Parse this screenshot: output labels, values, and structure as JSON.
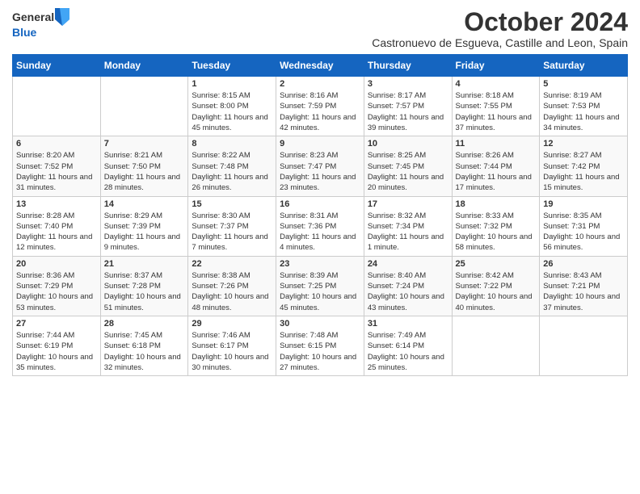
{
  "header": {
    "logo_general": "General",
    "logo_blue": "Blue",
    "main_title": "October 2024",
    "subtitle": "Castronuevo de Esgueva, Castille and Leon, Spain"
  },
  "days_of_week": [
    "Sunday",
    "Monday",
    "Tuesday",
    "Wednesday",
    "Thursday",
    "Friday",
    "Saturday"
  ],
  "weeks": [
    [
      {
        "day": "",
        "sunrise": "",
        "sunset": "",
        "daylight": ""
      },
      {
        "day": "",
        "sunrise": "",
        "sunset": "",
        "daylight": ""
      },
      {
        "day": "1",
        "sunrise": "Sunrise: 8:15 AM",
        "sunset": "Sunset: 8:00 PM",
        "daylight": "Daylight: 11 hours and 45 minutes."
      },
      {
        "day": "2",
        "sunrise": "Sunrise: 8:16 AM",
        "sunset": "Sunset: 7:59 PM",
        "daylight": "Daylight: 11 hours and 42 minutes."
      },
      {
        "day": "3",
        "sunrise": "Sunrise: 8:17 AM",
        "sunset": "Sunset: 7:57 PM",
        "daylight": "Daylight: 11 hours and 39 minutes."
      },
      {
        "day": "4",
        "sunrise": "Sunrise: 8:18 AM",
        "sunset": "Sunset: 7:55 PM",
        "daylight": "Daylight: 11 hours and 37 minutes."
      },
      {
        "day": "5",
        "sunrise": "Sunrise: 8:19 AM",
        "sunset": "Sunset: 7:53 PM",
        "daylight": "Daylight: 11 hours and 34 minutes."
      }
    ],
    [
      {
        "day": "6",
        "sunrise": "Sunrise: 8:20 AM",
        "sunset": "Sunset: 7:52 PM",
        "daylight": "Daylight: 11 hours and 31 minutes."
      },
      {
        "day": "7",
        "sunrise": "Sunrise: 8:21 AM",
        "sunset": "Sunset: 7:50 PM",
        "daylight": "Daylight: 11 hours and 28 minutes."
      },
      {
        "day": "8",
        "sunrise": "Sunrise: 8:22 AM",
        "sunset": "Sunset: 7:48 PM",
        "daylight": "Daylight: 11 hours and 26 minutes."
      },
      {
        "day": "9",
        "sunrise": "Sunrise: 8:23 AM",
        "sunset": "Sunset: 7:47 PM",
        "daylight": "Daylight: 11 hours and 23 minutes."
      },
      {
        "day": "10",
        "sunrise": "Sunrise: 8:25 AM",
        "sunset": "Sunset: 7:45 PM",
        "daylight": "Daylight: 11 hours and 20 minutes."
      },
      {
        "day": "11",
        "sunrise": "Sunrise: 8:26 AM",
        "sunset": "Sunset: 7:44 PM",
        "daylight": "Daylight: 11 hours and 17 minutes."
      },
      {
        "day": "12",
        "sunrise": "Sunrise: 8:27 AM",
        "sunset": "Sunset: 7:42 PM",
        "daylight": "Daylight: 11 hours and 15 minutes."
      }
    ],
    [
      {
        "day": "13",
        "sunrise": "Sunrise: 8:28 AM",
        "sunset": "Sunset: 7:40 PM",
        "daylight": "Daylight: 11 hours and 12 minutes."
      },
      {
        "day": "14",
        "sunrise": "Sunrise: 8:29 AM",
        "sunset": "Sunset: 7:39 PM",
        "daylight": "Daylight: 11 hours and 9 minutes."
      },
      {
        "day": "15",
        "sunrise": "Sunrise: 8:30 AM",
        "sunset": "Sunset: 7:37 PM",
        "daylight": "Daylight: 11 hours and 7 minutes."
      },
      {
        "day": "16",
        "sunrise": "Sunrise: 8:31 AM",
        "sunset": "Sunset: 7:36 PM",
        "daylight": "Daylight: 11 hours and 4 minutes."
      },
      {
        "day": "17",
        "sunrise": "Sunrise: 8:32 AM",
        "sunset": "Sunset: 7:34 PM",
        "daylight": "Daylight: 11 hours and 1 minute."
      },
      {
        "day": "18",
        "sunrise": "Sunrise: 8:33 AM",
        "sunset": "Sunset: 7:32 PM",
        "daylight": "Daylight: 10 hours and 58 minutes."
      },
      {
        "day": "19",
        "sunrise": "Sunrise: 8:35 AM",
        "sunset": "Sunset: 7:31 PM",
        "daylight": "Daylight: 10 hours and 56 minutes."
      }
    ],
    [
      {
        "day": "20",
        "sunrise": "Sunrise: 8:36 AM",
        "sunset": "Sunset: 7:29 PM",
        "daylight": "Daylight: 10 hours and 53 minutes."
      },
      {
        "day": "21",
        "sunrise": "Sunrise: 8:37 AM",
        "sunset": "Sunset: 7:28 PM",
        "daylight": "Daylight: 10 hours and 51 minutes."
      },
      {
        "day": "22",
        "sunrise": "Sunrise: 8:38 AM",
        "sunset": "Sunset: 7:26 PM",
        "daylight": "Daylight: 10 hours and 48 minutes."
      },
      {
        "day": "23",
        "sunrise": "Sunrise: 8:39 AM",
        "sunset": "Sunset: 7:25 PM",
        "daylight": "Daylight: 10 hours and 45 minutes."
      },
      {
        "day": "24",
        "sunrise": "Sunrise: 8:40 AM",
        "sunset": "Sunset: 7:24 PM",
        "daylight": "Daylight: 10 hours and 43 minutes."
      },
      {
        "day": "25",
        "sunrise": "Sunrise: 8:42 AM",
        "sunset": "Sunset: 7:22 PM",
        "daylight": "Daylight: 10 hours and 40 minutes."
      },
      {
        "day": "26",
        "sunrise": "Sunrise: 8:43 AM",
        "sunset": "Sunset: 7:21 PM",
        "daylight": "Daylight: 10 hours and 37 minutes."
      }
    ],
    [
      {
        "day": "27",
        "sunrise": "Sunrise: 7:44 AM",
        "sunset": "Sunset: 6:19 PM",
        "daylight": "Daylight: 10 hours and 35 minutes."
      },
      {
        "day": "28",
        "sunrise": "Sunrise: 7:45 AM",
        "sunset": "Sunset: 6:18 PM",
        "daylight": "Daylight: 10 hours and 32 minutes."
      },
      {
        "day": "29",
        "sunrise": "Sunrise: 7:46 AM",
        "sunset": "Sunset: 6:17 PM",
        "daylight": "Daylight: 10 hours and 30 minutes."
      },
      {
        "day": "30",
        "sunrise": "Sunrise: 7:48 AM",
        "sunset": "Sunset: 6:15 PM",
        "daylight": "Daylight: 10 hours and 27 minutes."
      },
      {
        "day": "31",
        "sunrise": "Sunrise: 7:49 AM",
        "sunset": "Sunset: 6:14 PM",
        "daylight": "Daylight: 10 hours and 25 minutes."
      },
      {
        "day": "",
        "sunrise": "",
        "sunset": "",
        "daylight": ""
      },
      {
        "day": "",
        "sunrise": "",
        "sunset": "",
        "daylight": ""
      }
    ]
  ]
}
